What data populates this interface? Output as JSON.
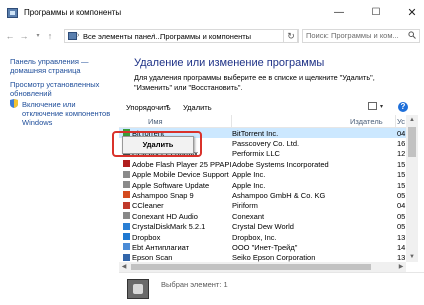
{
  "window": {
    "title": "Программы и компоненты",
    "min": "—",
    "max": "☐",
    "close": "✕"
  },
  "nav": {
    "back": "←",
    "forward": "→",
    "recent": "▾",
    "up": "↑"
  },
  "address": {
    "crumb1": "Все элементы панел...",
    "crumb2": "Программы и компоненты",
    "sep": "›",
    "refresh": "↻"
  },
  "search": {
    "placeholder": "Поиск: Программы и ком..."
  },
  "sidebar": {
    "home": "Панель управления — домашняя страница",
    "updates": "Просмотр установленных обновлений",
    "features": "Включение или отключение компонентов Windows"
  },
  "main": {
    "title": "Удаление или изменение программы",
    "description": "Для удаления программы выберите ее в списке и щелкните \"Удалить\", \"Изменить\" или \"Восстановить\"."
  },
  "toolbar": {
    "organize": "Упорядочить",
    "arrow": "▾",
    "delete": "Удалить",
    "help": "?"
  },
  "table": {
    "headers": {
      "name": "Имя",
      "publisher": "Издатель",
      "version": "Ус"
    },
    "rows": [
      {
        "name": "BitTorrent",
        "publisher": "BitTorrent Inc.",
        "version": "04",
        "color": "#3a9d3a"
      },
      {
        "name": "Passcovery Suite",
        "publisher": "Passcovery Co. Ltd.",
        "version": "16",
        "color": "#2d6fb0"
      },
      {
        "name": "CCleaner Performix",
        "publisher": "Performix LLC",
        "version": "12",
        "color": "#5a5a5a"
      },
      {
        "name": "Adobe Flash Player 25 PPAPI",
        "publisher": "Adobe Systems Incorporated",
        "version": "15",
        "color": "#b01e1e"
      },
      {
        "name": "Apple Mobile Device Support",
        "publisher": "Apple Inc.",
        "version": "15",
        "color": "#8a8a8a"
      },
      {
        "name": "Apple Software Update",
        "publisher": "Apple Inc.",
        "version": "15",
        "color": "#8a8a8a"
      },
      {
        "name": "Ashampoo Snap 9",
        "publisher": "Ashampoo GmbH & Co. KG",
        "version": "05",
        "color": "#d44b1f"
      },
      {
        "name": "CCleaner",
        "publisher": "Piriform",
        "version": "04",
        "color": "#c0392b"
      },
      {
        "name": "Conexant HD Audio",
        "publisher": "Conexant",
        "version": "05",
        "color": "#888888"
      },
      {
        "name": "CrystalDiskMark 5.2.1",
        "publisher": "Crystal Dew World",
        "version": "05",
        "color": "#2a7fd4"
      },
      {
        "name": "Dropbox",
        "publisher": "Dropbox, Inc.",
        "version": "13",
        "color": "#1f78d1"
      },
      {
        "name": "Ebt Антиплагиат",
        "publisher": "ООО \"Инет-Трейд\"",
        "version": "14",
        "color": "#4b8bd6"
      },
      {
        "name": "Epson Scan",
        "publisher": "Seiko Epson Corporation",
        "version": "13",
        "color": "#3366aa"
      }
    ]
  },
  "context_menu": {
    "delete": "Удалить"
  },
  "details": {
    "text": "Выбран элемент: 1"
  },
  "scroll": {
    "up": "▲",
    "down": "▼",
    "left": "◀",
    "right": "▶"
  }
}
